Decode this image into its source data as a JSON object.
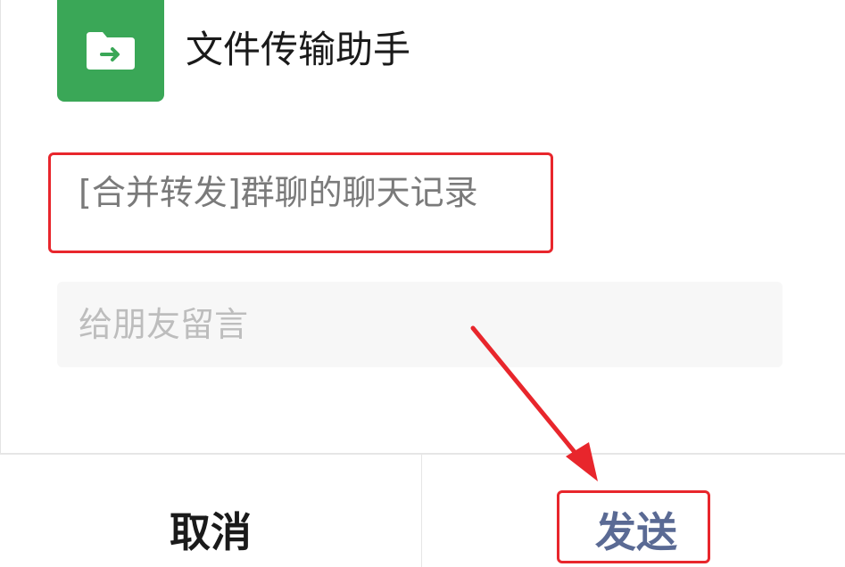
{
  "recipient": {
    "name": "文件传输助手",
    "avatar_icon": "folder-forward-icon",
    "avatar_color": "#3aa757"
  },
  "message": {
    "preview": "[合并转发]群聊的聊天记录"
  },
  "leave_message": {
    "placeholder": "给朋友留言",
    "value": ""
  },
  "footer": {
    "cancel_label": "取消",
    "send_label": "发送",
    "send_color": "#5a6a94"
  },
  "annotation": {
    "color": "#e8262c"
  }
}
